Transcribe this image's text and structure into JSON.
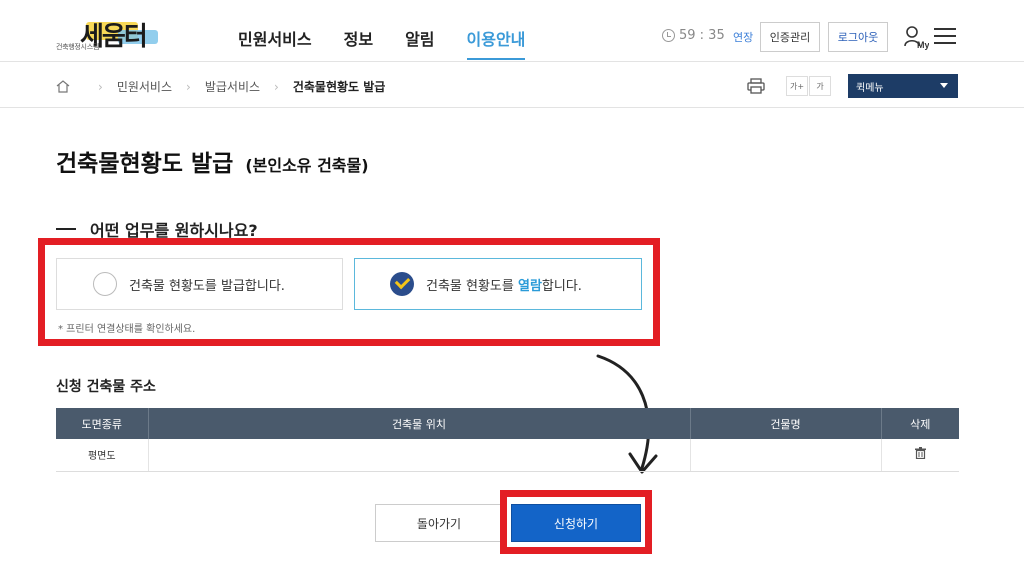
{
  "header": {
    "logo_text": "세움터",
    "logo_subtext": "건축행정시스템",
    "nav": [
      "민원서비스",
      "정보",
      "알림",
      "이용안내"
    ],
    "active_nav": "이용안내",
    "timer": "59 : 35",
    "extend_label": "연장",
    "cert_label": "인증관리",
    "logout_label": "로그아웃",
    "my_label": "My"
  },
  "breadcrumb": {
    "items": [
      "민원서비스",
      "발급서비스",
      "건축물현황도 발급"
    ],
    "font_plus": "가+",
    "font_minus": "가",
    "quick_menu": "퀵메뉴"
  },
  "page": {
    "title": "건축물현황도 발급",
    "title_sub": "(본인소유 건축물)",
    "question": "어떤 업무를 원하시나요?",
    "option_issue": "건축물 현황도를 발급합니다.",
    "option_view_prefix": "건축물 현황도를 ",
    "option_view_highlight": "열람",
    "option_view_suffix": "합니다.",
    "note": "* 프린터 연결상태를 확인하세요.",
    "section_title": "신청 건축물 주소",
    "table": {
      "headers": [
        "도면종류",
        "건축물 위치",
        "건물명",
        "삭제"
      ],
      "rows": [
        [
          "평면도",
          "",
          "",
          ""
        ]
      ]
    },
    "back_button": "돌아가기",
    "apply_button": "신청하기"
  },
  "colors": {
    "accent": "#3b9ad8",
    "highlight_red": "#e31e24",
    "apply_blue": "#1364c8",
    "table_header": "#4a5a6c",
    "quick_menu": "#1d3c66"
  }
}
